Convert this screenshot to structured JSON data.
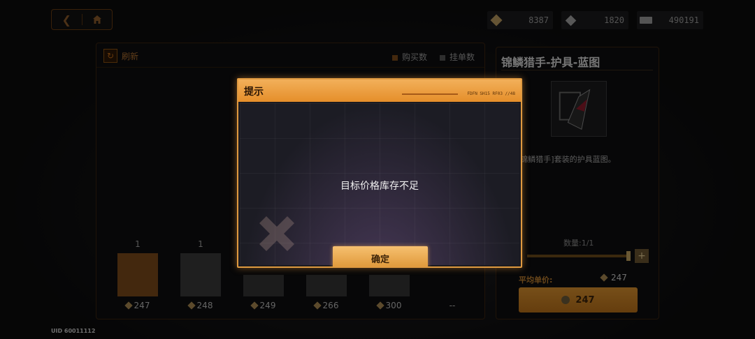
{
  "resources": [
    {
      "icon": "gem-icon",
      "value": "8387"
    },
    {
      "icon": "diamond-icon",
      "value": "1820"
    },
    {
      "icon": "cash-icon",
      "value": "490191"
    }
  ],
  "market": {
    "refresh_label": "刷新",
    "legend": {
      "buy": "购买数",
      "sell": "挂单数"
    },
    "bars": [
      {
        "count": "1",
        "price": "247",
        "level": 1,
        "color": "#7a4a1a"
      },
      {
        "count": "1",
        "price": "248",
        "level": 1,
        "color": "#3a3a3a"
      },
      {
        "count": "",
        "price": "249",
        "level": 0.5,
        "color": "#333333"
      },
      {
        "count": "",
        "price": "266",
        "level": 0.5,
        "color": "#333333"
      },
      {
        "count": "",
        "price": "300",
        "level": 0.5,
        "color": "#333333"
      },
      {
        "count": "",
        "price": "--",
        "level": 0,
        "color": "#333333"
      }
    ]
  },
  "item": {
    "title": "锦鳞猎手-护具-蓝图",
    "description": "[锦鳞猎手]套装的护具蓝图。",
    "quantity_label": "数量:1/1",
    "avg_price_label": "平均单价:",
    "avg_price": "247",
    "buy_price": "247"
  },
  "uid": "UID 60011112",
  "dialog": {
    "title": "提示",
    "code": "FDFN SH15 RF03 //48",
    "message": "目标价格库存不足",
    "confirm_label": "确定"
  },
  "colors": {
    "accent": "#e09a40",
    "dialog_header": "#f2b05a"
  }
}
